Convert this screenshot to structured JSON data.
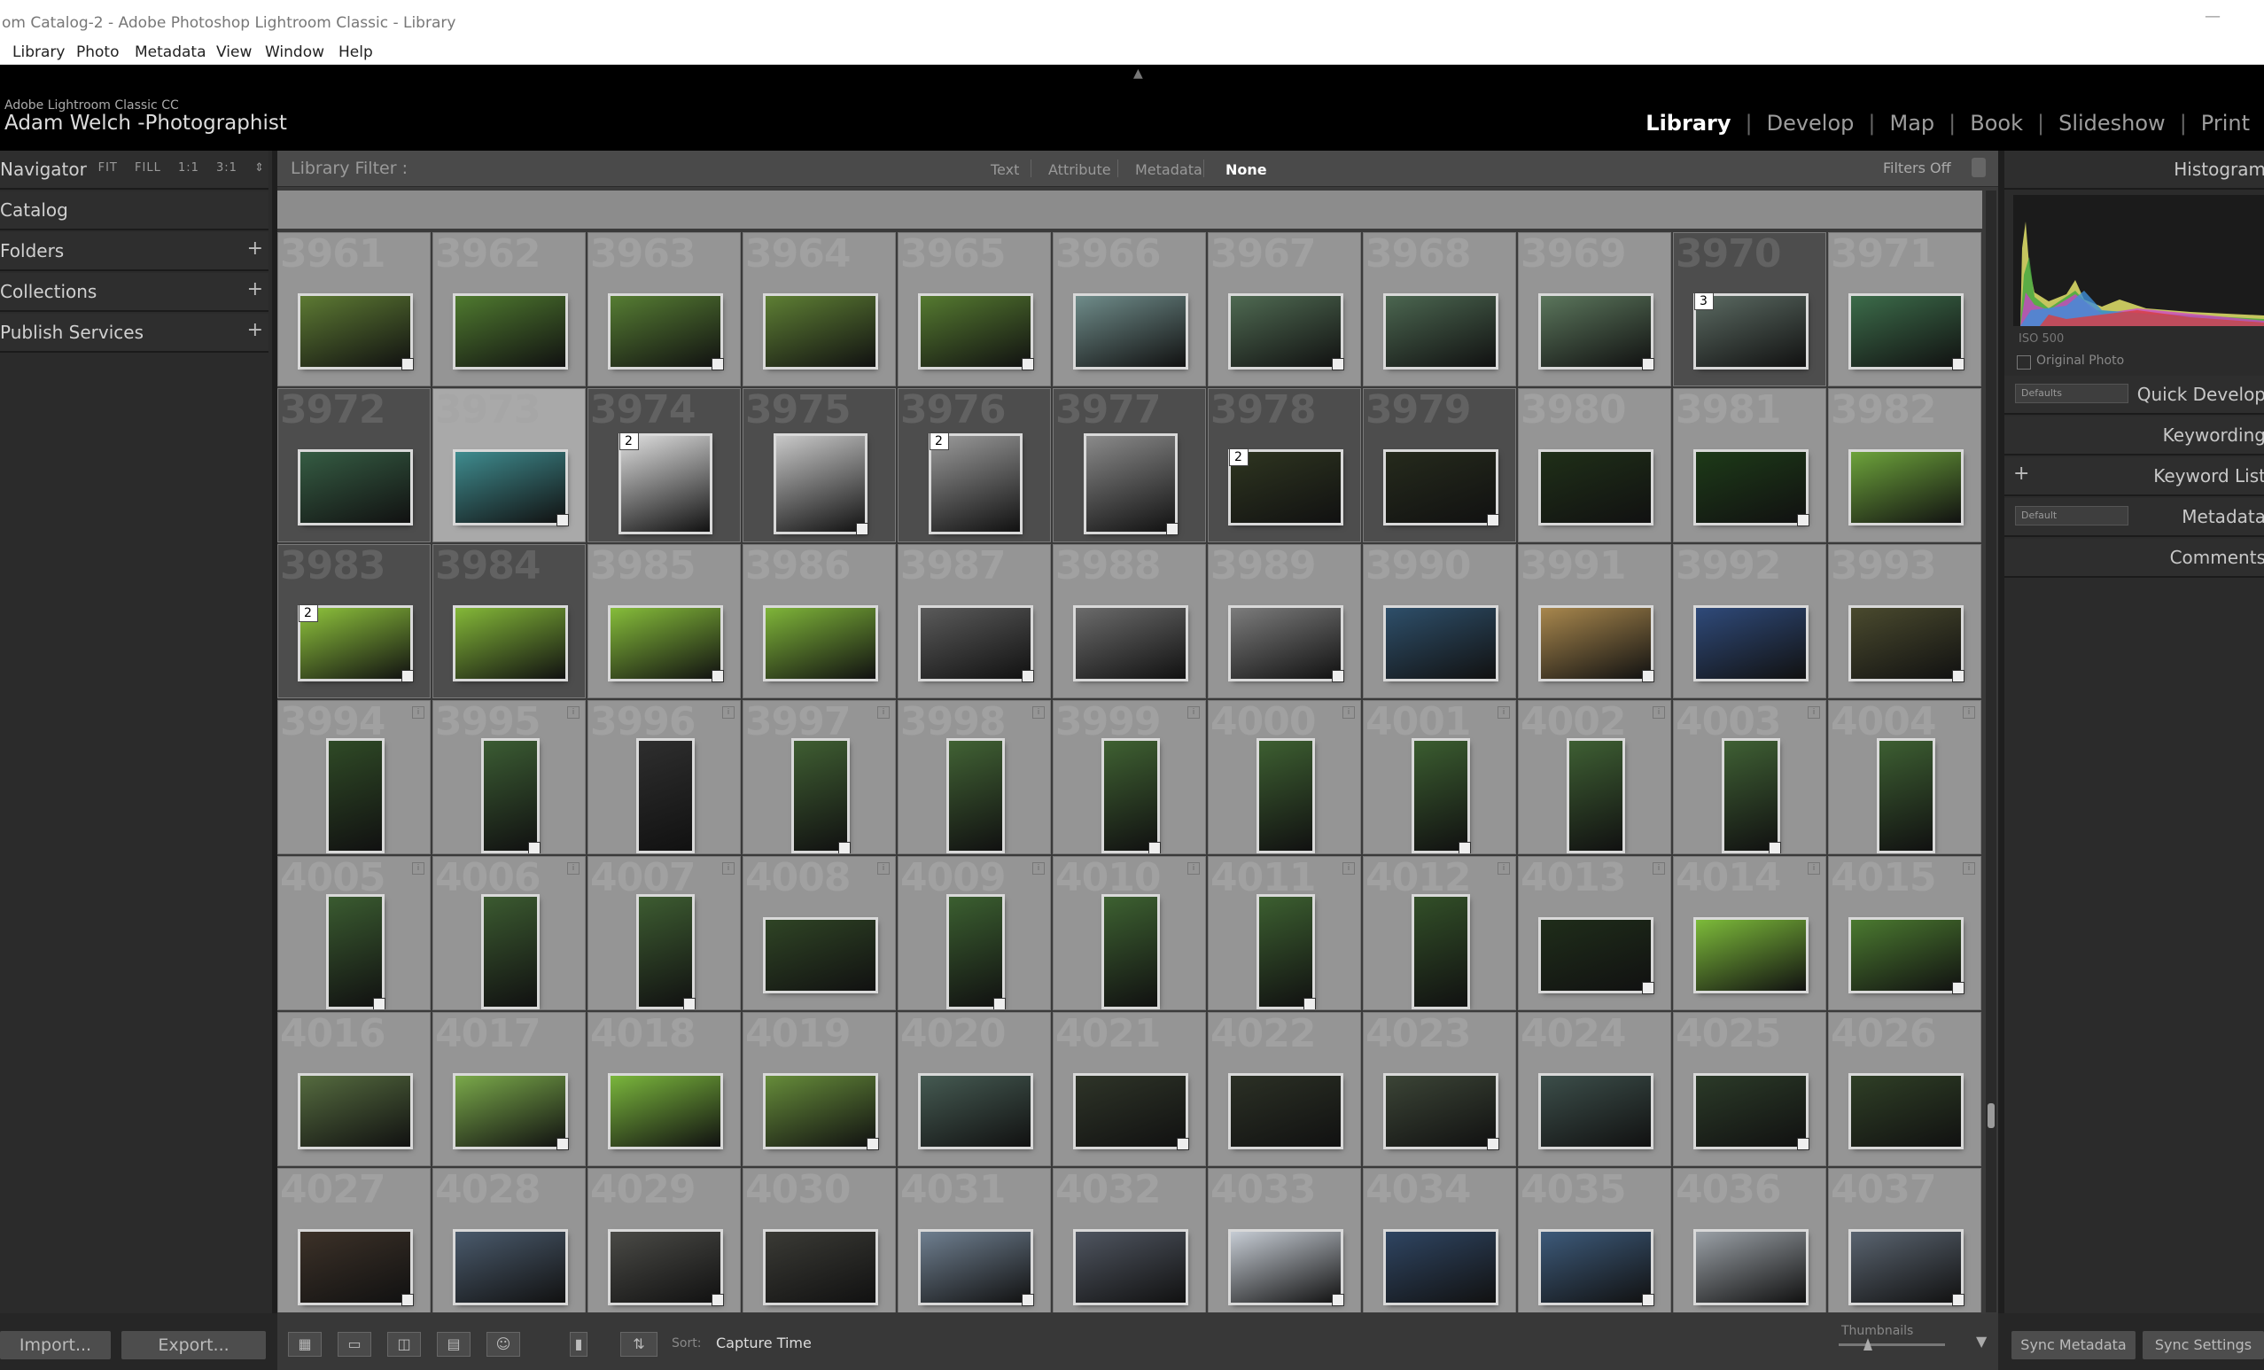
{
  "window": {
    "title": "om Catalog-2 - Adobe Photoshop Lightroom Classic - Library",
    "minimize": "—"
  },
  "menu": [
    "Library",
    "Photo",
    "Metadata",
    "View",
    "Window",
    "Help"
  ],
  "identity": {
    "product": "Adobe Lightroom Classic CC",
    "name": "Adam Welch -Photographist"
  },
  "modules": [
    {
      "label": "Library",
      "active": true
    },
    {
      "label": "Develop",
      "active": false
    },
    {
      "label": "Map",
      "active": false
    },
    {
      "label": "Book",
      "active": false
    },
    {
      "label": "Slideshow",
      "active": false
    },
    {
      "label": "Print",
      "active": false
    }
  ],
  "left_panel": {
    "navigator": "Navigator",
    "nav_options": [
      "FIT",
      "FILL",
      "1:1",
      "3:1"
    ],
    "sections": [
      {
        "label": "Catalog",
        "plus": ""
      },
      {
        "label": "Folders",
        "plus": "+"
      },
      {
        "label": "Collections",
        "plus": "+"
      },
      {
        "label": "Publish Services",
        "plus": "+"
      }
    ],
    "import": "Import...",
    "export": "Export..."
  },
  "filter_bar": {
    "label": "Library Filter :",
    "options": [
      {
        "label": "Text",
        "active": false
      },
      {
        "label": "Attribute",
        "active": false
      },
      {
        "label": "Metadata",
        "active": false
      },
      {
        "label": "None",
        "active": true
      }
    ],
    "filters": "Filters Off"
  },
  "grid": {
    "columns": 11,
    "rows": [
      {
        "numbers": [
          "3961",
          "3962",
          "3963",
          "3964",
          "3965",
          "3966",
          "3967",
          "3968",
          "3969",
          "3970",
          "3971"
        ],
        "colors": [
          "#5d7a33",
          "#4f7a2f",
          "#567d33",
          "#5e7f34",
          "#557a30",
          "#6f8c8a",
          "#4f6a52",
          "#4b6650",
          "#5b765c",
          "#5b6a62",
          "#3c6c4a"
        ]
      },
      {
        "numbers": [
          "3972",
          "3973",
          "3974",
          "3975",
          "3976",
          "3977",
          "3978",
          "3979",
          "3980",
          "3981",
          "3982"
        ],
        "colors": [
          "#355c43",
          "#3f8c8f",
          "#dedede",
          "#c8c8c8",
          "#9a9a9a",
          "#8a8a8a",
          "#2e3520",
          "#252a1c",
          "#1f2f18",
          "#1d3a18",
          "#6da33b"
        ]
      },
      {
        "numbers": [
          "3983",
          "3984",
          "3985",
          "3986",
          "3987",
          "3988",
          "3989",
          "3990",
          "3991",
          "3992",
          "3993"
        ],
        "colors": [
          "#8fc43c",
          "#84b838",
          "#86bd3a",
          "#7fb539",
          "#5a5a5a",
          "#6b6b6b",
          "#7c7c7c",
          "#2e4f6a",
          "#a8874d",
          "#2f4a7a",
          "#4a4a2e"
        ]
      },
      {
        "numbers": [
          "3994",
          "3995",
          "3996",
          "3997",
          "3998",
          "3999",
          "4000",
          "4001",
          "4002",
          "4003",
          "4004"
        ],
        "colors": [
          "#2f4a26",
          "#3b5c33",
          "#2e2e2e",
          "#3f5e32",
          "#416234",
          "#3f6132",
          "#3d5f31",
          "#3b5d30",
          "#3e5f33",
          "#3f6034",
          "#3d5f32"
        ]
      },
      {
        "numbers": [
          "4005",
          "4006",
          "4007",
          "4008",
          "4009",
          "4010",
          "4011",
          "4012",
          "4013",
          "4014",
          "4015"
        ],
        "colors": [
          "#3a5b30",
          "#3b5a30",
          "#3d5c31",
          "#2f4425",
          "#3b5f30",
          "#3d6131",
          "#3c5f30",
          "#324f28",
          "#1f2d1a",
          "#7dbb3a",
          "#4b7a30"
        ]
      },
      {
        "numbers": [
          "4016",
          "4017",
          "4018",
          "4019",
          "4020",
          "4021",
          "4022",
          "4023",
          "4024",
          "4025",
          "4026"
        ],
        "colors": [
          "#556b3f",
          "#7aa94a",
          "#7ab63c",
          "#668c3a",
          "#455a52",
          "#2e3428",
          "#2b3025",
          "#3b4436",
          "#3c4e4a",
          "#2b3a28",
          "#2f3f26"
        ]
      },
      {
        "numbers": [
          "4027",
          "4028",
          "4029",
          "4030",
          "4031",
          "4032",
          "4033",
          "4034",
          "4035",
          "4036",
          "4037"
        ],
        "colors": [
          "#3c3128",
          "#4a5a6c",
          "#4a4a46",
          "#3a3a35",
          "#6f7f90",
          "#4f5560",
          "#c6ccd4",
          "#2f4562",
          "#3d5a7a",
          "#9aa0a6",
          "#5a6470"
        ]
      }
    ]
  },
  "right_panel": {
    "histogram": "Histogram",
    "iso": "ISO 500",
    "original_photo": "Original Photo",
    "preset_default": "Defaults",
    "preset_meta": "Default",
    "sections": [
      "Quick Develop",
      "Keywording",
      "Keyword List",
      "Metadata",
      "Comments"
    ],
    "sync_metadata": "Sync Metadata",
    "sync_settings": "Sync Settings"
  },
  "toolbar": {
    "sort_label": "Sort:",
    "sort_value": "Capture Time",
    "thumbnails": "Thumbnails"
  }
}
